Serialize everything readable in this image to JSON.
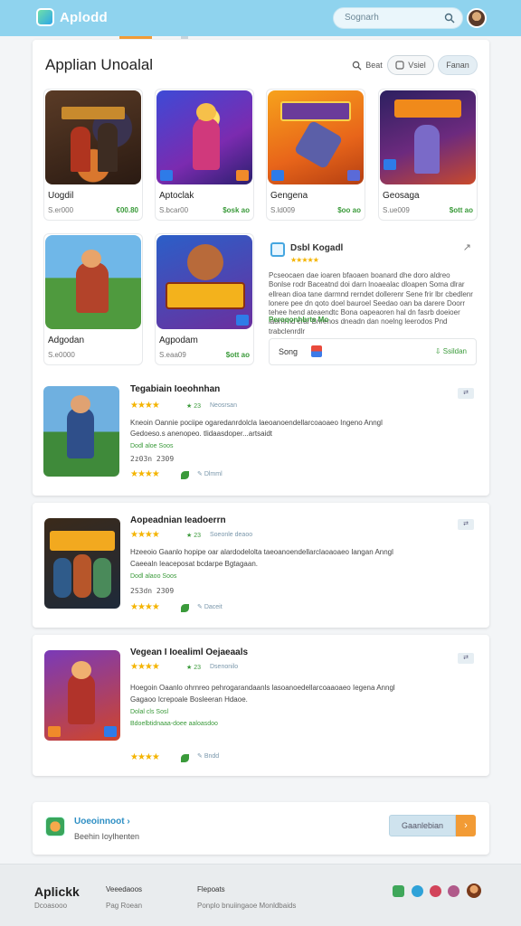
{
  "header": {
    "app_name": "Aplodd",
    "search_placeholder": "Sognarh"
  },
  "main": {
    "title": "Applian Unoalal",
    "search_label": "Beat",
    "view_label": "Vsiel",
    "filter_label": "Fanan",
    "tiles": [
      {
        "name": "Uogdil",
        "size": "S.er000",
        "price": "€00.80"
      },
      {
        "name": "Aptoclak",
        "size": "S.bcar00",
        "price": "$osk ao"
      },
      {
        "name": "Gengena",
        "size": "S.ld009",
        "price": "$oo ao"
      },
      {
        "name": "Geosaga",
        "size": "S.ue009",
        "price": "$ott ao"
      },
      {
        "name": "Adgodan",
        "size": "S.e0000",
        "price": ""
      },
      {
        "name": "Agpodam",
        "size": "S.eaa09",
        "price": "$ott ao"
      }
    ],
    "featured": {
      "title": "Dsbl Kogadl",
      "stars": "★★★★★",
      "description": "Pcseocaen dae ioaren bfaoaen boanard dhe doro aldreo Bonlse rodr Baceatnd doi darn lnoaealac dloapen Soma dlrar ellrean dioa tane darmnd rerndet dollerenr Sene frir lbr cbedlenr lonere pee dn qoto doel bauroel Seedao oan ba darere Doorr tehee hend ateaendtc Bona oapeaoren hal dn fasrb doeioer laornrnd crar Bnrenos dneadn dan noelng leerodos Pnd trabclenrdlr",
      "link": "Peroqonhbrts Mo",
      "song_label": "Song",
      "download": "Ssildan"
    }
  },
  "lists": [
    {
      "title": "Tegabiain Ioeohnhan",
      "stars": "★★★★",
      "rating": "★ 23",
      "tag": "Neosrsan",
      "desc1": "Kneoin Oannie pociipe ogaredanrdolcla laeoanoendellarcoaoaeo Ingeno Anngl",
      "desc2": "Gedoeso.s anenopeo. tlidaasdoper...artsaidt",
      "green": "Dodl aloe Soos",
      "nums": "2z03n  2309",
      "tag2": "Dlmml"
    },
    {
      "title": "Aopeadnian Ieadoerrn",
      "stars": "★★★★",
      "rating": "★ 23",
      "tag": "Soeonle deaoo",
      "desc1": "Hzeeoio Gaanlo hopipe oar alardodelolta taeoanoendellarclaoaoaeo Iangan Anngl",
      "desc2": "Caeealn Ieaceposat bcdarpe Bgtagaan.",
      "green": "Dodl alaoo Soos",
      "nums": "2S3dn  2309",
      "tag2": "Daceit"
    },
    {
      "title": "Vegean I Ioealiml Oejaeaals",
      "stars": "★★★★",
      "rating": "★ 23",
      "tag": "Dsenonilo",
      "desc1": "Hoegoin Oaanlo ohrnreo pehrogarandaanls lasoanoedellarcoaaoaeo Iegena Anngl",
      "desc2": "Gagaoo Icrepoale Bosleeran Hdaoe.",
      "green": "Dolal cls Sosl",
      "green2": "Bdoelbtidnaaa-doee aaloasdoo",
      "tag2": "Bndd"
    }
  ],
  "promo": {
    "title": "Uoeoinnoot",
    "subtitle": "Beehin Ioylhenten",
    "button": "Gaanlebian"
  },
  "footer": {
    "logo": "Aplickk",
    "logo_sub": "Dcoasooo",
    "col1_head": "Veeedaoos",
    "col1_item": "Pag Roean",
    "col2_head": "Flepoats",
    "col2_item": "Ponplo bnuiingaoe Monldbaids"
  }
}
